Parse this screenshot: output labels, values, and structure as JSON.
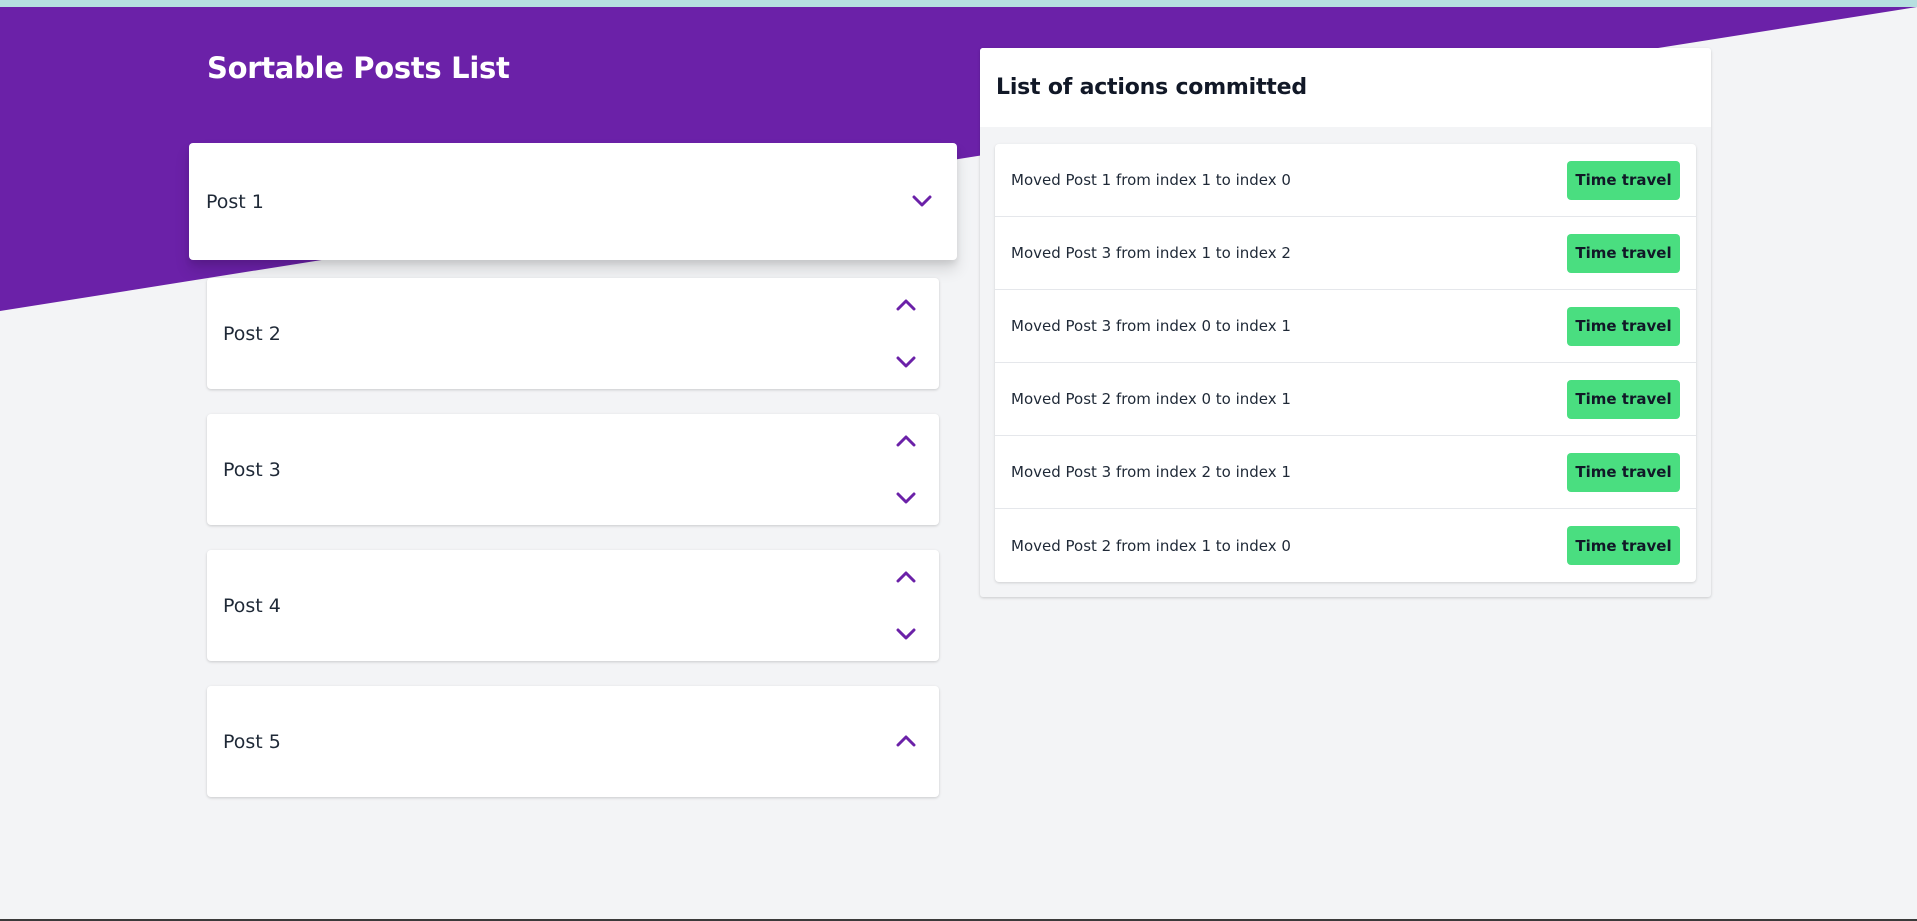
{
  "colors": {
    "brand_purple": "#6b21a8",
    "page_background": "#f3f4f6",
    "button_green": "#4ade80",
    "top_strip": "#b6dfe0"
  },
  "page": {
    "title": "Sortable Posts List"
  },
  "posts": [
    {
      "label": "Post 1",
      "controls": [
        "move-down"
      ]
    },
    {
      "label": "Post 2",
      "controls": [
        "move-up",
        "move-down"
      ]
    },
    {
      "label": "Post 3",
      "controls": [
        "move-up",
        "move-down"
      ]
    },
    {
      "label": "Post 4",
      "controls": [
        "move-up",
        "move-down"
      ]
    },
    {
      "label": "Post 5",
      "controls": [
        "move-up"
      ]
    }
  ],
  "actions_panel": {
    "title": "List of actions committed",
    "button_label": "Time travel",
    "actions": [
      {
        "text": "Moved Post 1 from index 1 to index 0"
      },
      {
        "text": "Moved Post 3 from index 1 to index 2"
      },
      {
        "text": "Moved Post 3 from index 0 to index 1"
      },
      {
        "text": "Moved Post 2 from index 0 to index 1"
      },
      {
        "text": "Moved Post 3 from index 2 to index 1"
      },
      {
        "text": "Moved Post 2 from index 1 to index 0"
      }
    ]
  },
  "icons": {
    "up": "chevron-up-icon",
    "down": "chevron-down-icon"
  }
}
